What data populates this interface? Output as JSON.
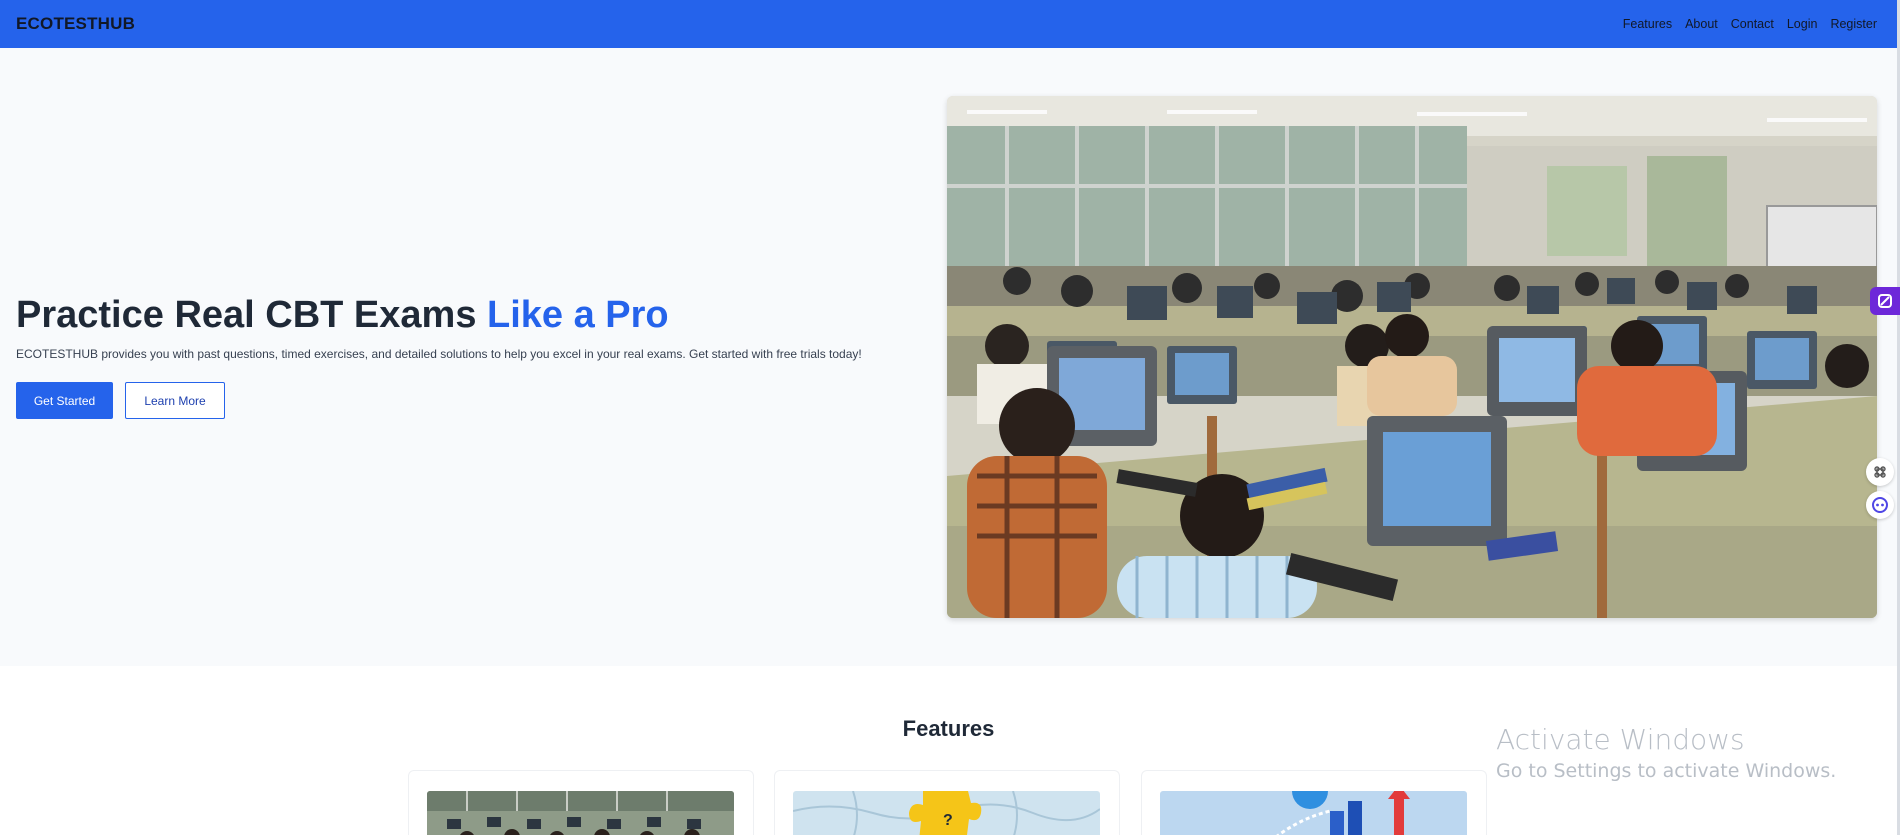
{
  "navbar": {
    "brand": "ECOTESTHUB",
    "links": [
      "Features",
      "About",
      "Contact",
      "Login",
      "Register"
    ],
    "background": "#2563eb"
  },
  "hero": {
    "title_main": "Practice Real CBT Exams ",
    "title_accent": "Like a Pro",
    "subtitle": "ECOTESTHUB provides you with past questions, timed exercises, and detailed solutions to help you excel in your real exams. Get started with free trials today!",
    "primary_button": "Get Started",
    "secondary_button": "Learn More",
    "image_icon": "computer-lab-photo",
    "accent_color": "#2563eb"
  },
  "features": {
    "title": "Features",
    "cards": [
      {
        "image_icon": "computer-lab-thumbnail"
      },
      {
        "image_icon": "puzzle-question-thumbnail"
      },
      {
        "image_icon": "growth-chart-thumbnail"
      }
    ]
  },
  "watermark": {
    "line1": "Activate Windows",
    "line2": "Go to Settings to activate Windows."
  },
  "side_widgets": [
    "extension-icon",
    "command-icon",
    "assistant-icon"
  ]
}
